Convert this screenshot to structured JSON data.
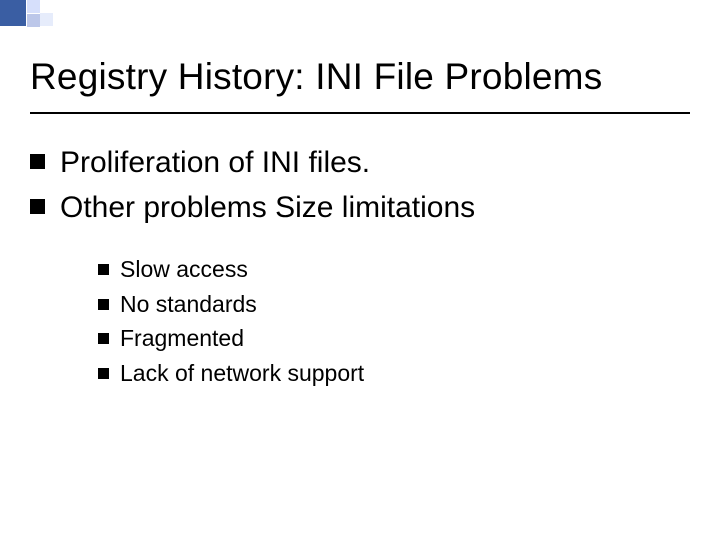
{
  "title": "Registry History: INI File Problems",
  "bullets": [
    {
      "text": "Proliferation of INI files."
    },
    {
      "text": "Other problems Size limitations"
    }
  ],
  "subbullets": [
    {
      "text": "Slow access"
    },
    {
      "text": "No standards"
    },
    {
      "text": "Fragmented"
    },
    {
      "text": "Lack of network support"
    }
  ]
}
